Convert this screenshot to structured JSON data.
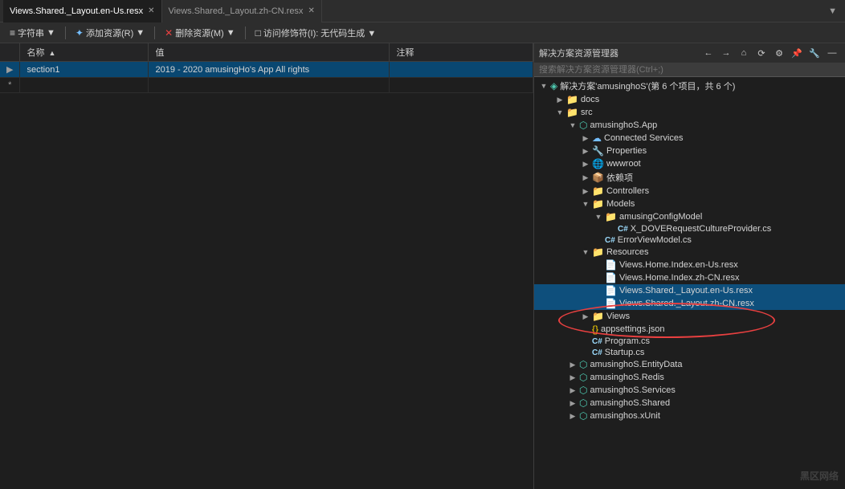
{
  "tabs": [
    {
      "id": "tab1",
      "label": "Views.Shared._Layout.en-Us.resx",
      "active": true
    },
    {
      "id": "tab2",
      "label": "Views.Shared._Layout.zh-CN.resx",
      "active": false
    }
  ],
  "toolbar": {
    "items": [
      {
        "id": "font",
        "label": "字符串",
        "icon": "≡"
      },
      {
        "id": "add",
        "label": "添加资源(R)",
        "icon": "✦"
      },
      {
        "id": "delete",
        "label": "删除资源(M)",
        "icon": "✕"
      },
      {
        "id": "access",
        "label": "访问修饰符(I):",
        "icon": "□"
      },
      {
        "id": "codegen",
        "label": "无代码生成",
        "icon": ""
      }
    ]
  },
  "resource_table": {
    "columns": [
      "名称",
      "值",
      "注释"
    ],
    "rows": [
      {
        "indicator": "▶",
        "name": "section1",
        "value": "2019 - 2020 amusingHo's App All rights",
        "comment": "",
        "selected": true
      },
      {
        "indicator": "*",
        "name": "",
        "value": "",
        "comment": "",
        "selected": false
      }
    ]
  },
  "solution_explorer": {
    "title": "解决方案资源管理器",
    "search_placeholder": "搜索解决方案资源管理器(Ctrl+;)",
    "toolbar_buttons": [
      "←",
      "→",
      "🏠",
      "📋",
      "⚙",
      "📌",
      "🔧",
      "—"
    ],
    "solution_label": "解决方案'amusinghoS'(第 6 个项目，共 6 个)",
    "tree": [
      {
        "level": 0,
        "icon": "📁",
        "icon_class": "icon-folder",
        "label": "docs",
        "expanded": false,
        "toggle": "▶"
      },
      {
        "level": 0,
        "icon": "📁",
        "icon_class": "icon-folder",
        "label": "src",
        "expanded": true,
        "toggle": "▼"
      },
      {
        "level": 1,
        "icon": "⬡",
        "icon_class": "icon-project",
        "label": "amusinghoS.App",
        "expanded": true,
        "toggle": "▼"
      },
      {
        "level": 2,
        "icon": "☁",
        "icon_class": "icon-connected",
        "label": "Connected Services",
        "expanded": false,
        "toggle": "▶"
      },
      {
        "level": 2,
        "icon": "🔧",
        "icon_class": "icon-gear",
        "label": "Properties",
        "expanded": false,
        "toggle": "▶"
      },
      {
        "level": 2,
        "icon": "🌐",
        "icon_class": "icon-globe",
        "label": "wwwroot",
        "expanded": false,
        "toggle": "▶"
      },
      {
        "level": 2,
        "icon": "📦",
        "icon_class": "icon-ref",
        "label": "依赖项",
        "expanded": false,
        "toggle": "▶"
      },
      {
        "level": 2,
        "icon": "📁",
        "icon_class": "icon-folder",
        "label": "Controllers",
        "expanded": false,
        "toggle": "▶"
      },
      {
        "level": 2,
        "icon": "📁",
        "icon_class": "icon-folder",
        "label": "Models",
        "expanded": true,
        "toggle": "▼"
      },
      {
        "level": 3,
        "icon": "📁",
        "icon_class": "icon-folder",
        "label": "amusingConfigModel",
        "expanded": true,
        "toggle": "▼"
      },
      {
        "level": 4,
        "icon": "C#",
        "icon_class": "icon-cs",
        "label": "X_DOVERequestCultureProvider.cs",
        "expanded": false,
        "toggle": ""
      },
      {
        "level": 3,
        "icon": "C#",
        "icon_class": "icon-cs",
        "label": "ErrorViewModel.cs",
        "expanded": false,
        "toggle": ""
      },
      {
        "level": 2,
        "icon": "📁",
        "icon_class": "icon-folder",
        "label": "Resources",
        "expanded": true,
        "toggle": "▼"
      },
      {
        "level": 3,
        "icon": "📄",
        "icon_class": "icon-resx",
        "label": "Views.Home.Index.en-Us.resx",
        "expanded": false,
        "toggle": ""
      },
      {
        "level": 3,
        "icon": "📄",
        "icon_class": "icon-resx",
        "label": "Views.Home.Index.zh-CN.resx",
        "expanded": false,
        "toggle": ""
      },
      {
        "level": 3,
        "icon": "📄",
        "icon_class": "icon-resx",
        "label": "Views.Shared._Layout.en-Us.resx",
        "expanded": false,
        "toggle": "",
        "highlighted": true
      },
      {
        "level": 3,
        "icon": "📄",
        "icon_class": "icon-resx",
        "label": "Views.Shared._Layout.zh-CN.resx",
        "expanded": false,
        "toggle": "",
        "highlighted": true
      },
      {
        "level": 2,
        "icon": "📁",
        "icon_class": "icon-folder",
        "label": "Views",
        "expanded": false,
        "toggle": "▶"
      },
      {
        "level": 2,
        "icon": "{}",
        "icon_class": "icon-json",
        "label": "appsettings.json",
        "expanded": false,
        "toggle": ""
      },
      {
        "level": 2,
        "icon": "C#",
        "icon_class": "icon-cs",
        "label": "Program.cs",
        "expanded": false,
        "toggle": ""
      },
      {
        "level": 2,
        "icon": "C#",
        "icon_class": "icon-cs",
        "label": "Startup.cs",
        "expanded": false,
        "toggle": ""
      },
      {
        "level": 1,
        "icon": "⬡",
        "icon_class": "icon-project",
        "label": "amusinghoS.EntityData",
        "expanded": false,
        "toggle": "▶"
      },
      {
        "level": 1,
        "icon": "⬡",
        "icon_class": "icon-project",
        "label": "amusinghoS.Redis",
        "expanded": false,
        "toggle": "▶"
      },
      {
        "level": 1,
        "icon": "⬡",
        "icon_class": "icon-project",
        "label": "amusinghoS.Services",
        "expanded": false,
        "toggle": "▶"
      },
      {
        "level": 1,
        "icon": "⬡",
        "icon_class": "icon-project",
        "label": "amusinghoS.Shared",
        "expanded": false,
        "toggle": "▶"
      },
      {
        "level": 1,
        "icon": "⬡",
        "icon_class": "icon-project",
        "label": "amusinghos.xUnit",
        "expanded": false,
        "toggle": "▶"
      }
    ]
  },
  "watermark": "黑区网络"
}
